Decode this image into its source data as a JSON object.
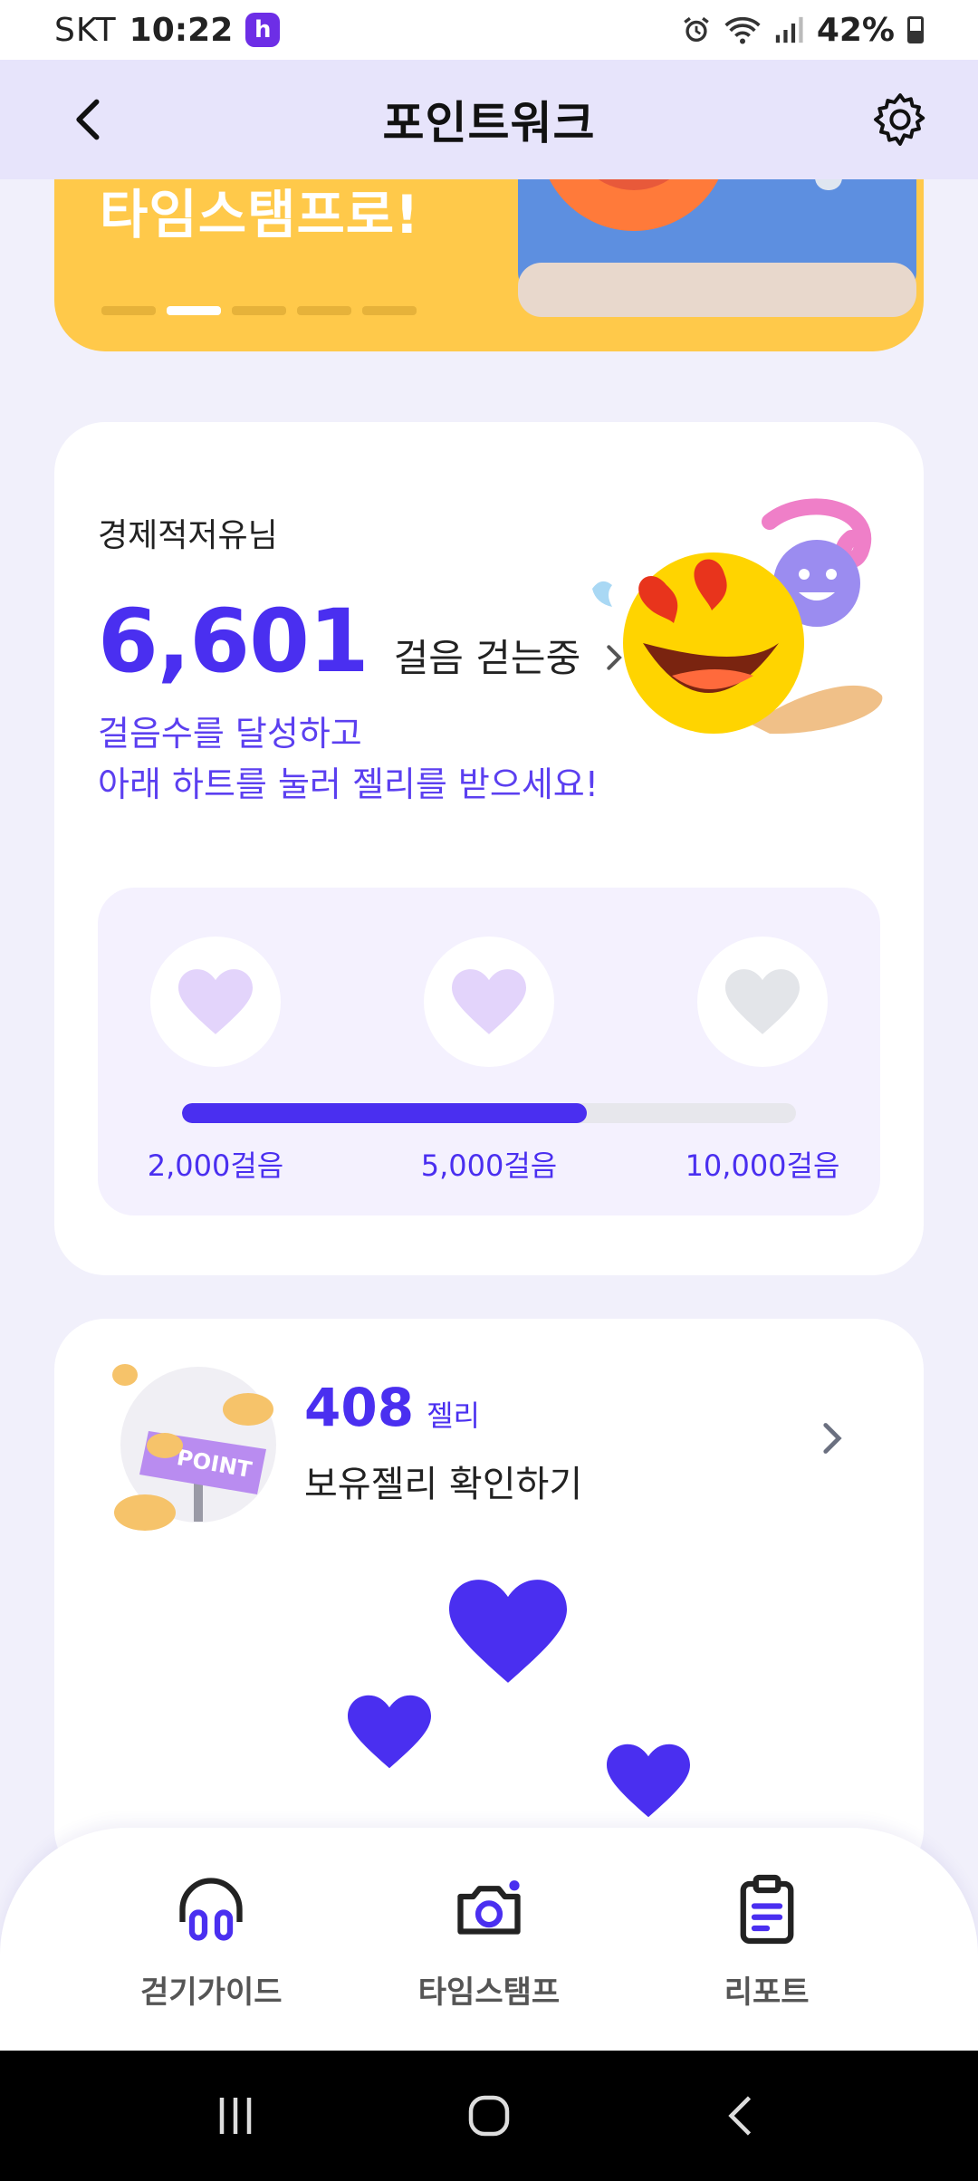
{
  "status_bar": {
    "carrier": "SKT",
    "time": "10:22",
    "app_badge": "h",
    "battery": "42%"
  },
  "header": {
    "title": "포인트워크",
    "back_icon": "chevron-left-icon",
    "settings_icon": "gear-icon"
  },
  "banner": {
    "text": "타임스탬프로!",
    "pages_total": 5,
    "page_active": 2
  },
  "steps_card": {
    "user_name": "경제적저유님",
    "step_count": "6,601",
    "step_label": "걸음 걷는중",
    "message_line1": "걸음수를 달성하고",
    "message_line2": "아래 하트를 눌러 젤리를 받으세요!",
    "progress_fraction": 0.66,
    "milestones": [
      {
        "label": "2,000걸음",
        "achieved": true
      },
      {
        "label": "5,000걸음",
        "achieved": true
      },
      {
        "label": "10,000걸음",
        "achieved": false
      }
    ]
  },
  "jelly_card": {
    "jelly_count": "408",
    "jelly_unit": "젤리",
    "link_label": "보유젤리 확인하기"
  },
  "bottom_nav": {
    "items": [
      {
        "label": "걷기가이드",
        "icon": "headphones-icon"
      },
      {
        "label": "타임스탬프",
        "icon": "camera-icon"
      },
      {
        "label": "리포트",
        "icon": "clipboard-icon"
      }
    ]
  },
  "colors": {
    "accent": "#4a2ff0",
    "header_bg": "#e7e4fb",
    "banner_bg": "#ffc94a",
    "heart_achieved": "#e3d4fb",
    "heart_locked": "#e3e5e9"
  }
}
